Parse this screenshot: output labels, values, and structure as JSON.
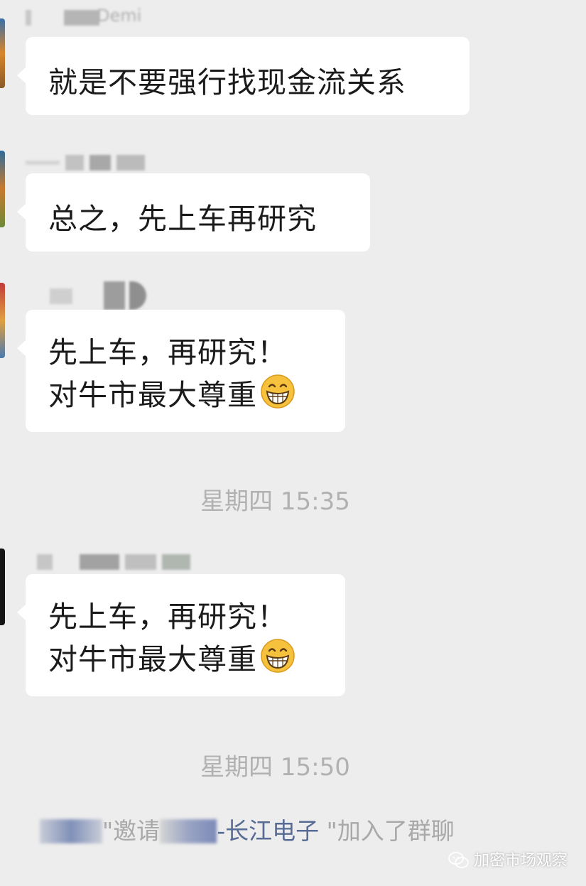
{
  "messages": [
    {
      "text": [
        "就是不要强行找现金流关系"
      ],
      "emoji": null
    },
    {
      "text": [
        "总之，先上车再研究"
      ],
      "emoji": null
    },
    {
      "text": [
        "先上车，再研究！",
        "对牛市最大尊重"
      ],
      "emoji": "grinning-face-emoji"
    },
    {
      "text": [
        "先上车，再研究！",
        "对牛市最大尊重"
      ],
      "emoji": "grinning-face-emoji"
    }
  ],
  "timestamps": [
    "星期四 15:35",
    "星期四 15:50"
  ],
  "system_message": {
    "quote_open": "\"邀请",
    "group_name": "-长江电子",
    "quote_close": " \"加入了群聊"
  },
  "top_sender_partial": "Demi",
  "watermark": "加密市场观察",
  "colors": {
    "background": "#ededed",
    "bubble": "#ffffff",
    "timestamp": "#b1b1b1",
    "link": "#576b95"
  }
}
